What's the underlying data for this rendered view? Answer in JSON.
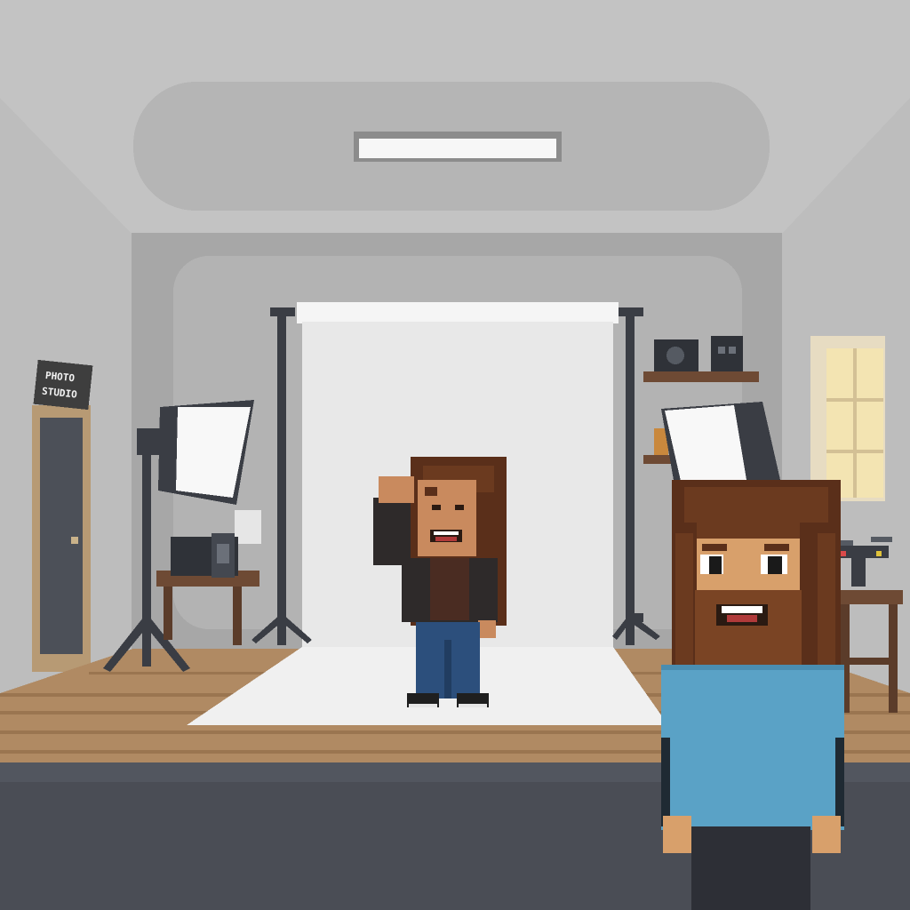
{
  "scene": {
    "style": "pixel-art",
    "location": "photo-studio",
    "colors": {
      "ceiling": "#c3c3c3",
      "ceiling_panel": "#b4b4b4",
      "back_wall": "#a9a9a9",
      "side_wall": "#b9b9b9",
      "backdrop": "#e9e9e9",
      "wood_floor": "#b08a63",
      "foreground_floor": "#4a4d55",
      "player_shirt": "#5aa2c6",
      "hair": "#6b3a1f"
    }
  },
  "door_sign": {
    "line1": "PHOTO",
    "line2": "STUDIO"
  },
  "characters": [
    {
      "id": "model",
      "pose": "hand-on-head",
      "expression": "laughing"
    },
    {
      "id": "player",
      "pose": "standing",
      "expression": "smiling"
    }
  ],
  "props": [
    "left-softbox-light",
    "right-softbox-light",
    "backdrop-stand",
    "camera-on-table",
    "camera-on-shelf",
    "drone-on-side-table",
    "ceiling-light",
    "window",
    "door"
  ]
}
